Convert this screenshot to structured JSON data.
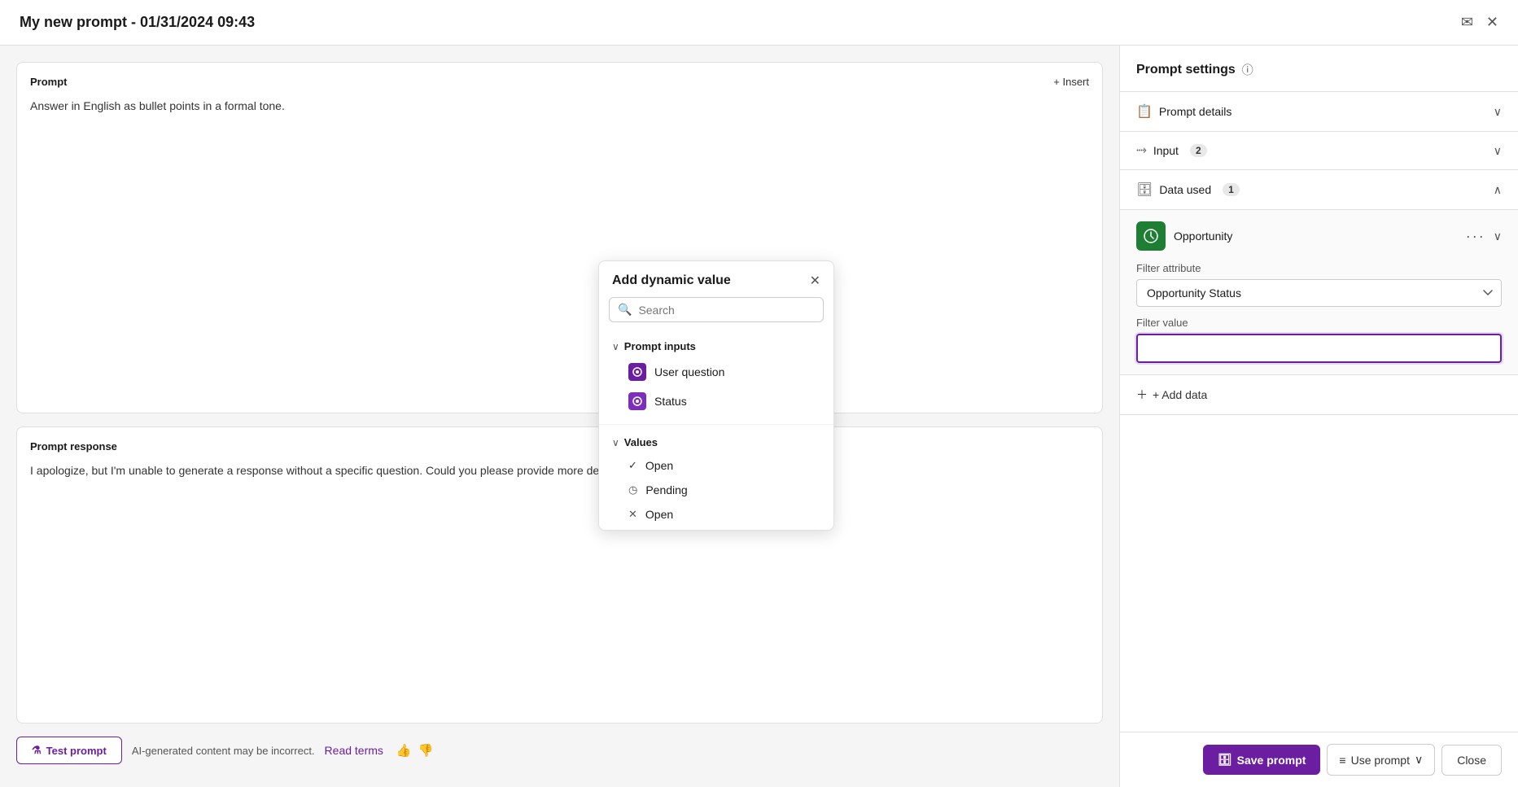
{
  "titleBar": {
    "title": "My new prompt - 01/31/2024 09:43",
    "sendIcon": "✉",
    "closeIcon": "✕"
  },
  "leftPanel": {
    "prompt": {
      "label": "Prompt",
      "insertButton": "+ Insert",
      "text": "Answer in English as bullet points in a formal tone."
    },
    "response": {
      "label": "Prompt response",
      "text": "I apologize, but I'm unable to generate a response without a specific question. Could you please provide more de..."
    },
    "footer": {
      "testPromptLabel": "Test prompt",
      "disclaimerText": "AI-generated content may be incorrect.",
      "readTermsText": "Read terms"
    }
  },
  "rightPanel": {
    "title": "Prompt settings",
    "infoIcon": "ⓘ",
    "sections": {
      "promptDetails": {
        "label": "Prompt details",
        "icon": "📋",
        "chevron": "∨"
      },
      "input": {
        "label": "Input",
        "badge": "2",
        "icon": "→",
        "chevron": "∨"
      },
      "dataUsed": {
        "label": "Data used",
        "badge": "1",
        "icon": "🗄",
        "chevron": "∧"
      }
    },
    "dataUsed": {
      "opportunityName": "Opportunity",
      "filterAttributeLabel": "Filter attribute",
      "filterAttributeValue": "Opportunity Status",
      "filterValueLabel": "Filter value",
      "filterValuePlaceholder": "",
      "addDataLabel": "+ Add data"
    },
    "footer": {
      "savePromptLabel": "Save prompt",
      "usePromptLabel": "Use prompt",
      "closeLabel": "Close"
    }
  },
  "dropdown": {
    "title": "Add dynamic value",
    "closeIcon": "✕",
    "search": {
      "placeholder": "Search"
    },
    "promptInputs": {
      "sectionLabel": "Prompt inputs",
      "items": [
        {
          "label": "User question",
          "iconColor": "#6b1fa0"
        },
        {
          "label": "Status",
          "iconColor": "#7b2fba"
        }
      ]
    },
    "values": {
      "sectionLabel": "Values",
      "items": [
        {
          "label": "Open",
          "icon": "✓",
          "iconType": "check"
        },
        {
          "label": "Pending",
          "icon": "◷",
          "iconType": "clock"
        },
        {
          "label": "Open",
          "icon": "✕",
          "iconType": "x"
        }
      ]
    }
  }
}
